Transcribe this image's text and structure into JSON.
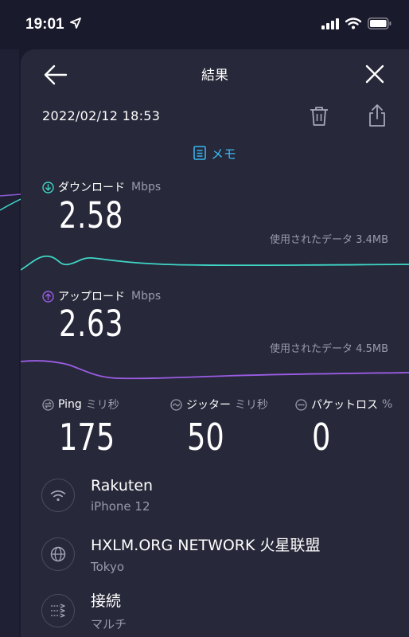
{
  "status_bar": {
    "time": "19:01"
  },
  "header": {
    "title": "結果"
  },
  "result": {
    "datetime": "2022/02/12 18:53",
    "memo_label": "メモ"
  },
  "download": {
    "label": "ダウンロード",
    "unit": "Mbps",
    "value": "2.58",
    "data_used": "使用されたデータ 3.4MB"
  },
  "upload": {
    "label": "アップロード",
    "unit": "Mbps",
    "value": "2.63",
    "data_used": "使用されたデータ 4.5MB"
  },
  "ping": {
    "label": "Ping",
    "unit": "ミリ秒",
    "value": "175"
  },
  "jitter": {
    "label": "ジッター",
    "unit": "ミリ秒",
    "value": "50"
  },
  "packet_loss": {
    "label": "パケットロス",
    "unit": "%",
    "value": "0"
  },
  "provider": {
    "name": "Rakuten",
    "device": "iPhone 12"
  },
  "server": {
    "name": "HXLM.ORG NETWORK 火星联盟",
    "location": "Tokyo"
  },
  "connection": {
    "label": "接続",
    "type": "マルチ"
  },
  "colors": {
    "download": "#3fd6c6",
    "upload": "#9b5de5",
    "accent": "#3ab5ee",
    "sheet": "#272839",
    "background": "#1a1a2d"
  },
  "icons": [
    "navigation-arrow-icon",
    "signal-icon",
    "wifi-icon",
    "battery-icon",
    "back-arrow-icon",
    "close-icon",
    "trash-icon",
    "share-icon",
    "memo-icon",
    "download-icon",
    "upload-icon",
    "ping-icon",
    "jitter-icon",
    "packet-loss-icon",
    "wifi-provider-icon",
    "globe-icon",
    "multi-connection-icon"
  ]
}
